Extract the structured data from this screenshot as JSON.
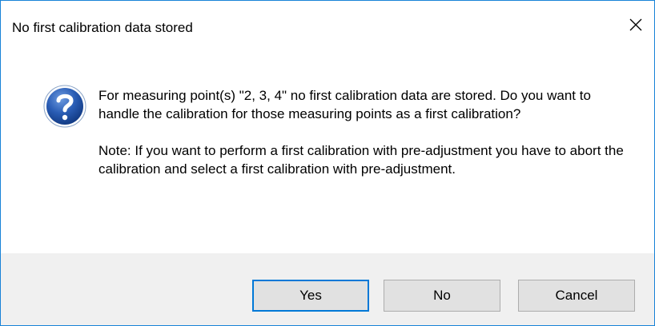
{
  "dialog": {
    "title": "No first calibration data stored",
    "icon": "question-icon",
    "message_line1": "For measuring point(s) \"2, 3, 4\" no first calibration data are stored. Do you want to handle the calibration for those measuring points as a first calibration?",
    "message_line2": "Note: If you want to perform a first calibration with pre-adjustment you have to abort the calibration and select a first calibration with pre-adjustment."
  },
  "buttons": {
    "yes_label": "Yes",
    "no_label": "No",
    "cancel_label": "Cancel"
  },
  "colors": {
    "window_border": "#1883d7",
    "button_bar_bg": "#f0f0f0",
    "default_button_border": "#0078d7",
    "icon_blue": "#2a5db5"
  }
}
